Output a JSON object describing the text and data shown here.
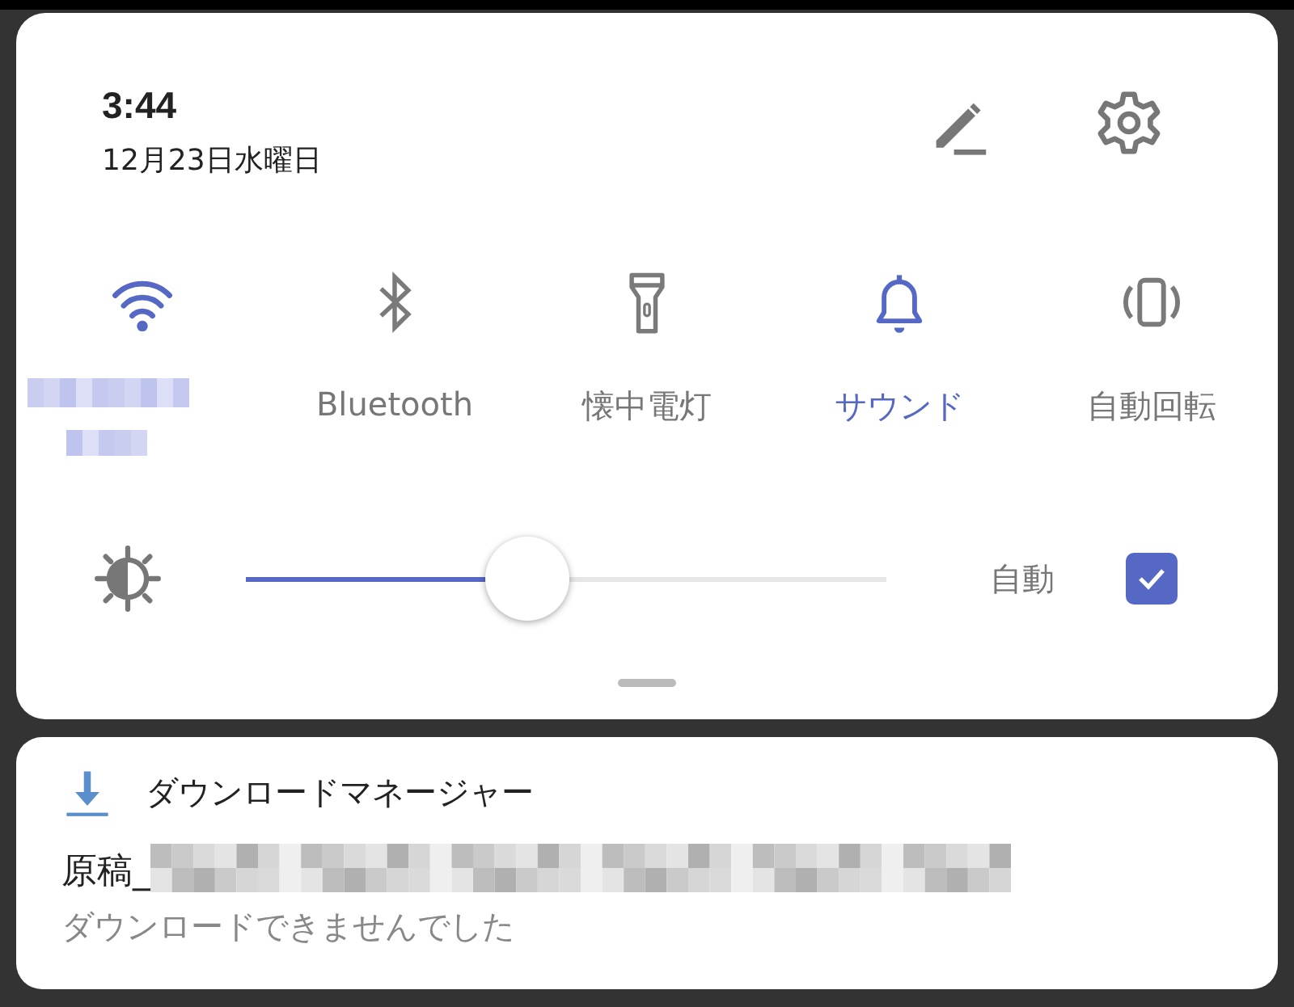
{
  "header": {
    "time": "3:44",
    "date": "12月23日水曜日"
  },
  "tiles": [
    {
      "kind": "wifi",
      "on": true
    },
    {
      "kind": "bluetooth",
      "on": false,
      "label": "Bluetooth"
    },
    {
      "kind": "flashlight",
      "on": false,
      "label": "懐中電灯"
    },
    {
      "kind": "sound",
      "on": true,
      "label": "サウンド"
    },
    {
      "kind": "rotate",
      "on": false,
      "label": "自動回転"
    }
  ],
  "brightness": {
    "level": 0.44,
    "auto_label": "自動",
    "auto_checked": true
  },
  "notification": {
    "app": "ダウンロードマネージャー",
    "file_prefix": "原稿_",
    "status": "ダウンロードできませんでした"
  }
}
